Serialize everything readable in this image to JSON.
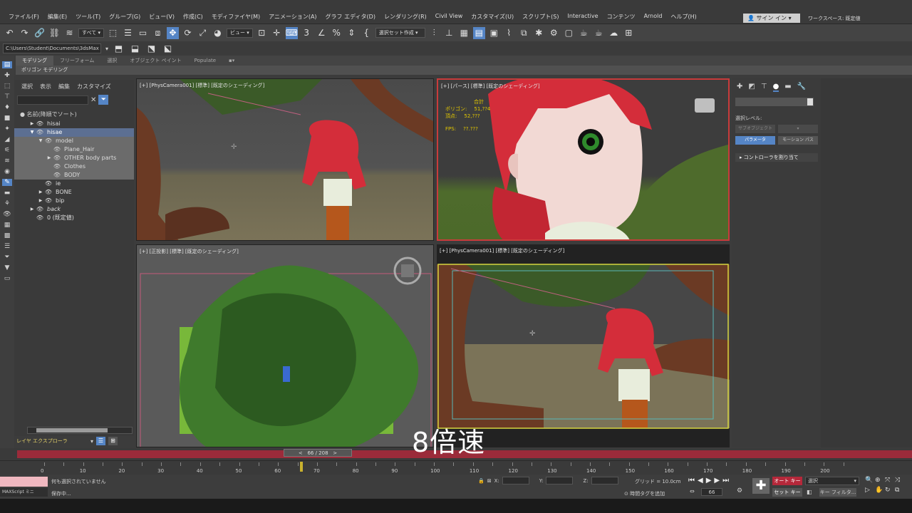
{
  "menus": [
    "ファイル(F)",
    "編集(E)",
    "ツール(T)",
    "グループ(G)",
    "ビュー(V)",
    "作成(C)",
    "モディファイヤ(M)",
    "アニメーション(A)",
    "グラフ エディタ(D)",
    "レンダリング(R)",
    "Civil View",
    "カスタマイズ(U)",
    "スクリプト(S)",
    "Interactive",
    "コンテンツ",
    "Arnold",
    "ヘルプ(H)"
  ],
  "signin": "サイン イン",
  "workspace": "ワークスペース: 既定値",
  "toolbar": {
    "filter_all": "すべて",
    "view": "ビュー",
    "selection_set": "選択セット作成"
  },
  "path": "C:\\Users\\Student\\Documents\\3dsMax",
  "ribbon_tabs": [
    "モデリング",
    "フリーフォーム",
    "選択",
    "オブジェクト ペイント",
    "Populate"
  ],
  "ribbon_sub": "ポリゴン モデリング",
  "explorer": {
    "tabs": [
      "選択",
      "表示",
      "編集",
      "カスタマイズ"
    ],
    "header": "名前(降順でソート)",
    "rows": [
      {
        "label": "hisai",
        "indent": 0,
        "arrow": "▶",
        "eye": true,
        "state": ""
      },
      {
        "label": "hisae",
        "indent": 0,
        "arrow": "▼",
        "eye": true,
        "state": "sel"
      },
      {
        "label": "model",
        "indent": 1,
        "arrow": "▼",
        "eye": true,
        "state": "hl"
      },
      {
        "label": "Plane_Hair",
        "indent": 2,
        "arrow": "",
        "eye": true,
        "state": "hl"
      },
      {
        "label": "OTHER body parts",
        "indent": 2,
        "arrow": "▶",
        "eye": true,
        "state": "hl"
      },
      {
        "label": "Clothes",
        "indent": 2,
        "arrow": "",
        "eye": true,
        "state": "hl"
      },
      {
        "label": "BODY",
        "indent": 2,
        "arrow": "",
        "eye": true,
        "state": "hl"
      },
      {
        "label": "ie",
        "indent": 1,
        "arrow": "",
        "eye": true,
        "state": ""
      },
      {
        "label": "BONE",
        "indent": 1,
        "arrow": "▶",
        "eye": true,
        "state": ""
      },
      {
        "label": "bip",
        "indent": 1,
        "arrow": "▶",
        "eye": true,
        "state": ""
      },
      {
        "label": "back",
        "indent": 0,
        "arrow": "▶",
        "eye": true,
        "state": ""
      },
      {
        "label": "0 (既定値)",
        "indent": 0,
        "arrow": "",
        "eye": true,
        "state": ""
      }
    ],
    "layer_label": "レイヤ エクスプローラ"
  },
  "viewports": {
    "vp1": "[+] [PhysCamera001] [標準] [既定のシェーディング]",
    "vp2": "[+] [パース] [標準] [既定のシェーディング]",
    "vp3": "[+] [正投影] [標準] [既定のシェーディング]",
    "vp4": "[+] [PhysCamera001] [標準] [既定のシェーディング]"
  },
  "stats": {
    "total": "合計",
    "poly_label": "ポリゴン:",
    "poly_value": "51,??4",
    "vert_label": "頂点:",
    "vert_value": "52,???",
    "fps_label": "FPS:",
    "fps_value": "??.???"
  },
  "command_panel": {
    "sel_level": "選択レベル:",
    "sub_object": "サブオブジェクト",
    "param_btn": "パラメータ",
    "motion_path_btn": "モーション パス",
    "rollout": "コントローラを割り当て"
  },
  "overlay": "8倍速",
  "time": {
    "frame_display": "66 / 208",
    "current": 66,
    "total": 208,
    "ticks": [
      0,
      10,
      20,
      30,
      40,
      50,
      60,
      70,
      80,
      90,
      100,
      110,
      120,
      130,
      140,
      150,
      160,
      170,
      180,
      190,
      200
    ]
  },
  "status": {
    "maxscript": "MAXScript ミニ",
    "line1": "何も選択されていません",
    "line2": "保存中...",
    "grid": "グリッド = 10.0cm",
    "add_tag": "時間タグを追加",
    "frame": "66",
    "x_label": "X:",
    "y_label": "Y:",
    "z_label": "Z:"
  },
  "anim": {
    "auto_key": "オート キー",
    "set_key": "セット キー",
    "select": "選択",
    "key_filter": "キー フィルタ..."
  },
  "colors": {
    "accent": "#5585c6",
    "timebar": "#9b2b3a",
    "autokey": "#b5283a",
    "stats": "#e3c800",
    "hair": "#d42d3a"
  }
}
